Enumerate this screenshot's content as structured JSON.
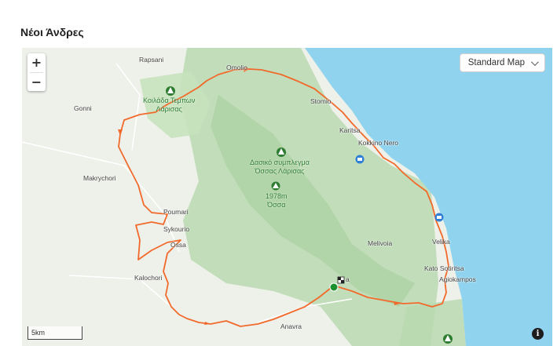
{
  "page": {
    "title": "Νέοι Άνδρες"
  },
  "controls": {
    "zoom_in": "+",
    "zoom_out": "−",
    "map_type": "Standard Map",
    "scale": "5km",
    "info": "i"
  },
  "colors": {
    "route": "#f26a2b",
    "sea": "#8fd3ee",
    "forest": "#b9d9b0",
    "land": "#eef0ea",
    "poi_green": "#2e7d32",
    "poi_blue": "#2f7fd6",
    "start_green": "#1a8f2e"
  },
  "places": {
    "rapsani": "Rapsani",
    "omolio": "Omolio",
    "gonni": "Gonni",
    "stomio": "Stomio",
    "karitsa": "Karitsa",
    "kokkino_nero": "Kokkino Nero",
    "makrychori": "Makrychori",
    "poumari": "Poumari",
    "sykourio": "Sykourio",
    "ossa": "Ossa",
    "melivoia": "Melivoia",
    "velika": "Velika",
    "kato_sotiritsa": "Kato Sotiritsa",
    "kalochori": "Kalochori",
    "agiokampos": "Agiokampos",
    "anavra": "Anavra",
    "finish_suffix": "a"
  },
  "poi": {
    "tempi_1": "Κοιλάδα Τεμπων",
    "tempi_2": "Λάρισας",
    "ossa_forest_1": "Δασικό συμπλεγμα",
    "ossa_forest_2": "Όσσας Λάρισας",
    "ossa_peak_1": "1978m",
    "ossa_peak_2": "Όσσα"
  }
}
